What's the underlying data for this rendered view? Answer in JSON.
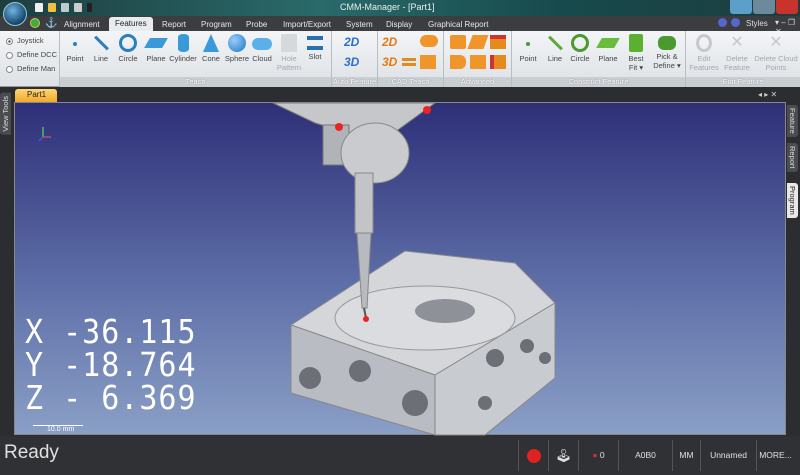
{
  "window": {
    "title": "CMM-Manager - [Part1]"
  },
  "tabs": [
    "Alignment",
    "Features",
    "Report",
    "Program",
    "Probe",
    "Import/Export",
    "System",
    "Display",
    "Graphical Report"
  ],
  "active_tab": "Features",
  "right_header": {
    "styles": "Styles"
  },
  "mode_options": [
    "Joystick",
    "Define DCC",
    "Define Man"
  ],
  "groups": {
    "teach": {
      "label": "Teach",
      "buttons": [
        "Point",
        "Line",
        "Circle",
        "Plane",
        "Cylinder",
        "Cone",
        "Sphere",
        "Cloud",
        "Hole Pattern",
        "Slot"
      ]
    },
    "auto_feature": {
      "label": "Auto Feature",
      "buttons": [
        "2D",
        "3D"
      ]
    },
    "cad_teach": {
      "label": "CAD Teach"
    },
    "advanced": {
      "label": "Advanced"
    },
    "construct": {
      "label": "Construct Feature",
      "buttons": [
        "Point",
        "Line",
        "Circle",
        "Plane",
        "Best Fit",
        "Pick & Define"
      ]
    },
    "edit": {
      "label": "Edit Feature",
      "buttons": [
        "Edit Features",
        "Delete Feature",
        "Delete Cloud Points"
      ]
    }
  },
  "document_tab": "Part1",
  "side_tabs": {
    "left": "View Tools",
    "right": [
      "Feature",
      "Report",
      "Program"
    ]
  },
  "readout": {
    "x": "X -36.115",
    "y": "Y -18.764",
    "z": "Z - 6.369",
    "scale": "10.0 mm"
  },
  "status": {
    "text": "Ready",
    "probe_count": "0",
    "tip": "A0B0",
    "units": "MM",
    "name": "Unnamed",
    "more": "MORE..."
  }
}
